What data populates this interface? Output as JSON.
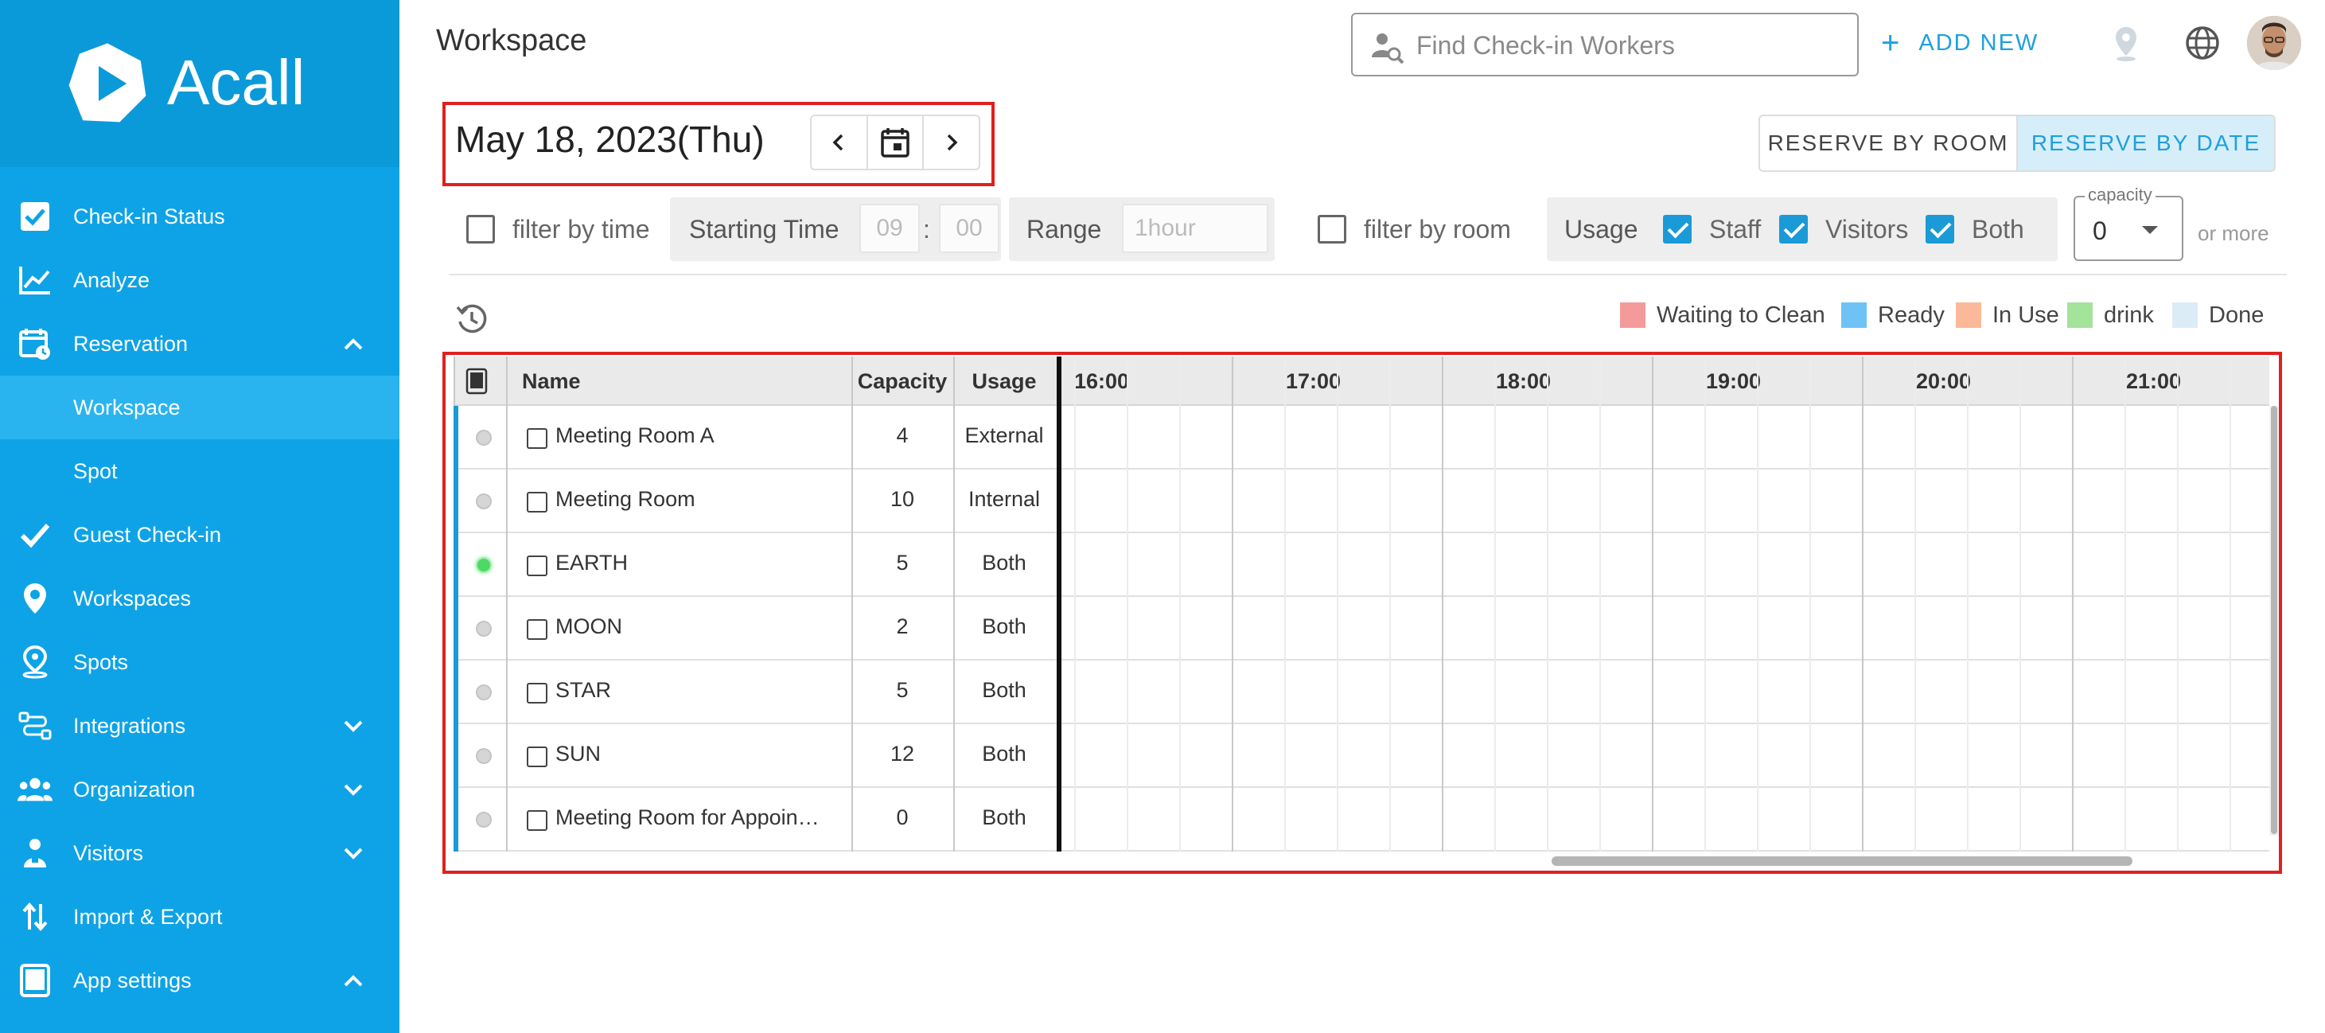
{
  "app": {
    "brand": "Acall",
    "brand_color": "#0ea3e6"
  },
  "sidebar": {
    "items": [
      {
        "label": "Check-in Status",
        "icon": "checkbox-icon"
      },
      {
        "label": "Analyze",
        "icon": "line-chart-icon"
      },
      {
        "label": "Reservation",
        "icon": "calendar-clock-icon",
        "expanded": true
      },
      {
        "label": "Workspace",
        "active": true,
        "sub": true
      },
      {
        "label": "Spot",
        "sub": true
      },
      {
        "label": "Guest Check-in",
        "icon": "checkmark-icon"
      },
      {
        "label": "Workspaces",
        "icon": "map-pin-icon"
      },
      {
        "label": "Spots",
        "icon": "location-person-icon"
      },
      {
        "label": "Integrations",
        "icon": "integrations-icon",
        "expanded": false
      },
      {
        "label": "Organization",
        "icon": "people-icon",
        "expanded": false
      },
      {
        "label": "Visitors",
        "icon": "visitor-icon",
        "expanded": false
      },
      {
        "label": "Import & Export",
        "icon": "import-export-icon"
      },
      {
        "label": "App settings",
        "icon": "tablet-icon",
        "expanded": true
      }
    ]
  },
  "header": {
    "title": "Workspace",
    "search_placeholder": "Find Check-in Workers",
    "add_new": "ADD NEW"
  },
  "date_nav": {
    "date": "May 18, 2023(Thu)"
  },
  "view_toggle": {
    "by_room": "RESERVE BY ROOM",
    "by_date": "RESERVE BY DATE",
    "selected": "by_date"
  },
  "filters": {
    "filter_by_time": "filter by time",
    "starting_time_label": "Starting Time",
    "start_hour": "09",
    "colon": ":",
    "start_min": "00",
    "range_label": "Range",
    "range_value": "1hour",
    "filter_by_room": "filter by room",
    "usage_label": "Usage",
    "usage_staff": "Staff",
    "usage_visitors": "Visitors",
    "usage_both": "Both",
    "capacity_label": "capacity",
    "capacity_value": "0",
    "or_more": "or more"
  },
  "legend": [
    {
      "label": "Waiting to Clean",
      "color": "#f49a9a"
    },
    {
      "label": "Ready",
      "color": "#6ec3f4"
    },
    {
      "label": "In Use",
      "color": "#fbb99a"
    },
    {
      "label": "drink",
      "color": "#a3e39a"
    },
    {
      "label": "Done",
      "color": "#dbecf7"
    }
  ],
  "table": {
    "columns": {
      "name": "Name",
      "capacity": "Capacity",
      "usage": "Usage"
    },
    "hours": [
      "16:00",
      "17:00",
      "18:00",
      "19:00",
      "20:00",
      "21:00"
    ],
    "rows": [
      {
        "name": "Meeting Room A",
        "capacity": "4",
        "usage": "External",
        "live": false
      },
      {
        "name": "Meeting Room",
        "capacity": "10",
        "usage": "Internal",
        "live": false
      },
      {
        "name": "EARTH",
        "capacity": "5",
        "usage": "Both",
        "live": true
      },
      {
        "name": "MOON",
        "capacity": "2",
        "usage": "Both",
        "live": false
      },
      {
        "name": "STAR",
        "capacity": "5",
        "usage": "Both",
        "live": false
      },
      {
        "name": "SUN",
        "capacity": "12",
        "usage": "Both",
        "live": false
      },
      {
        "name": "Meeting Room for Appoin…",
        "capacity": "0",
        "usage": "Both",
        "live": false
      }
    ]
  }
}
